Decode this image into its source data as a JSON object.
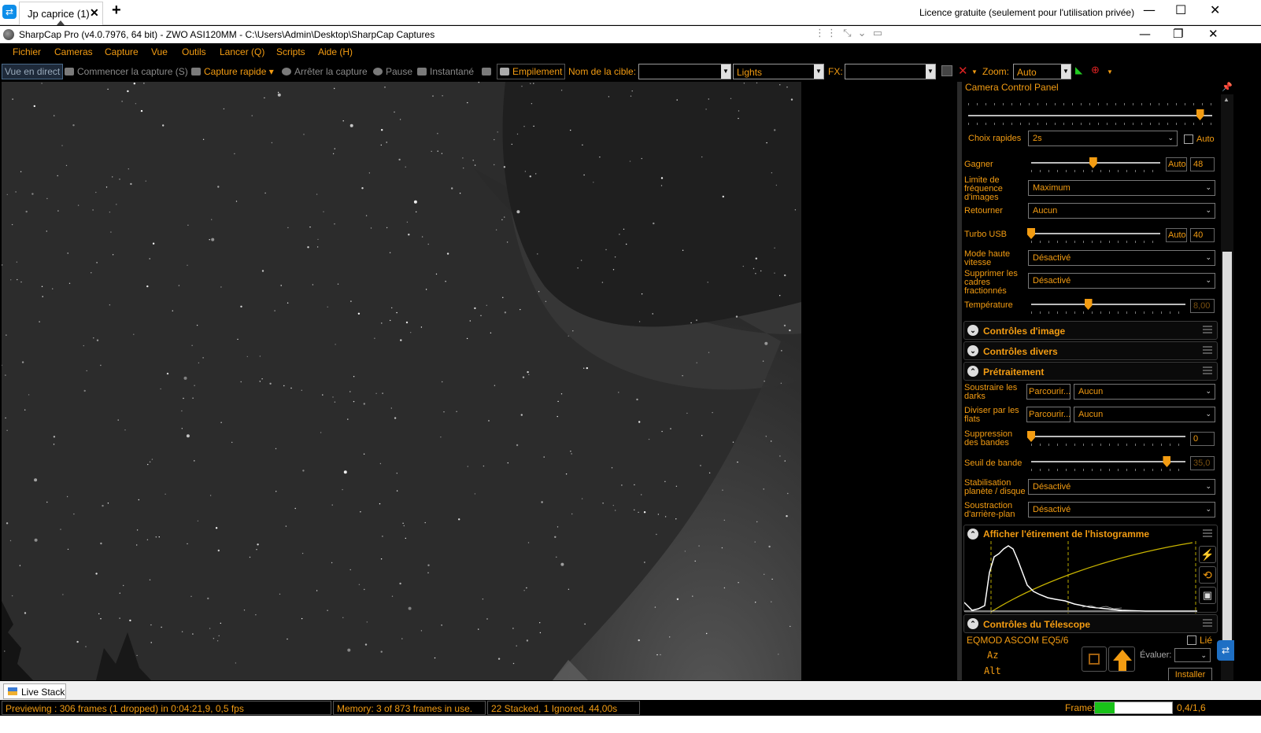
{
  "remote": {
    "tab_label": "Jp caprice (1)",
    "tab_close": "✕",
    "new_tab": "+",
    "license": "Licence gratuite (seulement pour l'utilisation privée)",
    "minimize": "—",
    "maximize": "☐",
    "close": "✕"
  },
  "window": {
    "title": "SharpCap Pro (v4.0.7976, 64 bit) - ZWO ASI120MM - C:\\Users\\Admin\\Desktop\\SharpCap Captures",
    "minimize": "—",
    "restore": "❐",
    "close": "✕"
  },
  "menu": [
    "Fichier",
    "Cameras",
    "Capture",
    "Vue",
    "Outils",
    "Lancer (Q)",
    "Scripts",
    "Aide (H)"
  ],
  "toolbar": {
    "live_view": "Vue en direct",
    "start_capture": "Commencer la capture (S)",
    "quick_capture": "Capture rapide",
    "stop_capture": "Arrêter la capture",
    "pause": "Pause",
    "snapshot": "Instantané",
    "stacking": "Empilement",
    "target_name_label": "Nom de la cible:",
    "target_name_value": "",
    "frame_type": "Lights",
    "fx_label": "FX:",
    "fx_value": "",
    "zoom_label": "Zoom:",
    "zoom_value": "Auto"
  },
  "panel": {
    "header": "Camera Control Panel",
    "quick_picks_label": "Choix rapides",
    "quick_picks_value": "2s",
    "auto_label": "Auto",
    "gain_label": "Gagner",
    "gain_auto": "Auto",
    "gain_value": "48",
    "gain_level": 0.48,
    "exposure_level": 0.95,
    "frame_rate_label": "Limite de fréquence d'images",
    "frame_rate_value": "Maximum",
    "flip_label": "Retourner",
    "flip_value": "Aucun",
    "usb_label": "Turbo USB",
    "usb_auto": "Auto",
    "usb_value": "40",
    "usb_level": 0.0,
    "highspeed_label": "Mode haute vitesse",
    "highspeed_value": "Désactivé",
    "partial_label": "Supprimer les cadres fractionnés",
    "partial_value": "Désactivé",
    "temp_label": "Température",
    "temp_value": "8,00",
    "temp_level": 0.37,
    "sec_image": "Contrôles d'image",
    "sec_misc": "Contrôles divers",
    "sec_preprocess": "Prétraitement",
    "darks_label": "Soustraire les darks",
    "darks_browse": "Parcourir...",
    "darks_value": "Aucun",
    "flats_label": "Diviser par les flats",
    "flats_browse": "Parcourir...",
    "flats_value": "Aucun",
    "banding_label": "Suppression des bandes",
    "banding_value": "0",
    "banding_level": 0.0,
    "band_thresh_label": "Seuil de bande",
    "band_thresh_value": "35,0",
    "band_thresh_level": 0.88,
    "stabilize_label": "Stabilisation planète / disque",
    "stabilize_value": "Désactivé",
    "bg_sub_label": "Soustraction d'arrière-plan",
    "bg_sub_value": "Désactivé",
    "sec_histogram": "Afficher l'étirement de l'histogramme",
    "sec_telescope": "Contrôles du Télescope",
    "mount_name": "EQMOD ASCOM EQ5/6",
    "linked_label": "Lié",
    "az_label": "Az",
    "alt_label": "Alt",
    "evaluate_label": "Évaluer:",
    "install_button": "Installer"
  },
  "bottom": {
    "live_stack_tab": "Live Stack",
    "status_preview": "Previewing : 306 frames (1 dropped) in 0:04:21,9, 0,5 fps",
    "status_memory": "Memory: 3 of 873 frames in use.",
    "status_stack": "22 Stacked, 1 Ignored, 44,00s",
    "frame_label": "Frame:",
    "frame_value": "0,4/1,6",
    "frame_fraction": 0.25
  },
  "colors": {
    "accent": "#f39c12",
    "background": "#000000",
    "sky": "#2e2e2e",
    "histogram_curve": "#ffffff",
    "histogram_stretch": "#c8b400"
  }
}
